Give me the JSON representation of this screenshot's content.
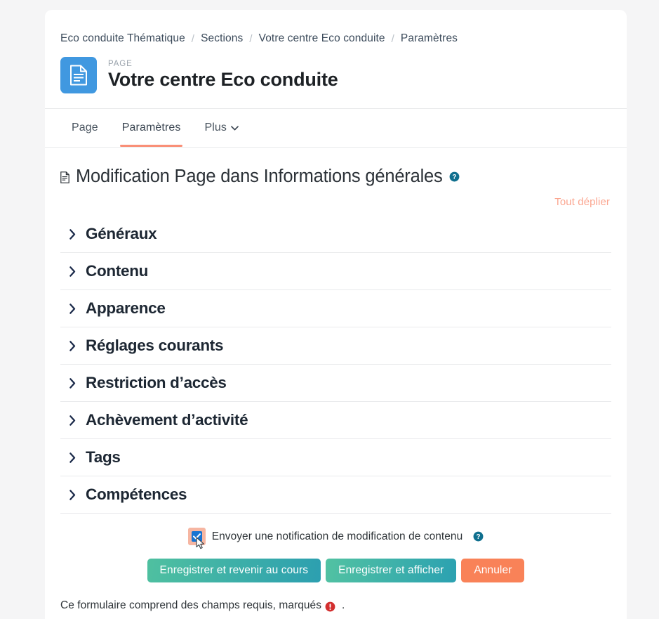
{
  "breadcrumb": {
    "separator": "/",
    "items": [
      {
        "label": "Eco conduite Thématique"
      },
      {
        "label": "Sections"
      },
      {
        "label": "Votre centre Eco conduite"
      },
      {
        "label": "Paramètres"
      }
    ]
  },
  "header": {
    "icon": "page-document-icon",
    "kicker": "PAGE",
    "title": "Votre centre Eco conduite"
  },
  "tabs": [
    {
      "label": "Page",
      "active": false
    },
    {
      "label": "Paramètres",
      "active": true
    },
    {
      "label": "Plus",
      "active": false,
      "caret": "⌄"
    }
  ],
  "form": {
    "heading": "Modification Page dans Informations générales",
    "heading_icon": "document-small-icon",
    "help_icon": "help-circle-icon",
    "expand_all_label": "Tout déplier"
  },
  "sections": [
    {
      "label": "Généraux",
      "expanded": false
    },
    {
      "label": "Contenu",
      "expanded": false
    },
    {
      "label": "Apparence",
      "expanded": false
    },
    {
      "label": "Réglages courants",
      "expanded": false
    },
    {
      "label": "Restriction d’accès",
      "expanded": false
    },
    {
      "label": "Achèvement d’activité",
      "expanded": false
    },
    {
      "label": "Tags",
      "expanded": false
    },
    {
      "label": "Compétences",
      "expanded": false
    }
  ],
  "notification": {
    "checked": true,
    "label": "Envoyer une notification de modification de contenu",
    "help_icon": "help-circle-icon"
  },
  "actions": {
    "save_return_label": "Enregistrer et revenir au cours",
    "save_display_label": "Enregistrer et afficher",
    "cancel_label": "Annuler"
  },
  "footer": {
    "note_before": "Ce formulaire comprend des champs requis, marqués",
    "required_icon": "required-exclamation-icon",
    "note_after": "."
  },
  "colors": {
    "accent_coral": "#f98f77",
    "link_coral": "#fba58f",
    "icon_blue": "#4098e0",
    "help_teal": "#0f6f8e",
    "checkbox_blue": "#1874d2",
    "checkbox_focus": "#f6b6a2",
    "btn_teal_start": "#4fc0a0",
    "btn_teal_end": "#2c9fb0",
    "btn_cancel": "#f98258",
    "required_red": "#d32f2f",
    "page_bg": "#f5f5f6",
    "card_bg": "#ffffff",
    "divider": "#e9eaec",
    "text_dark": "#1d2733"
  }
}
